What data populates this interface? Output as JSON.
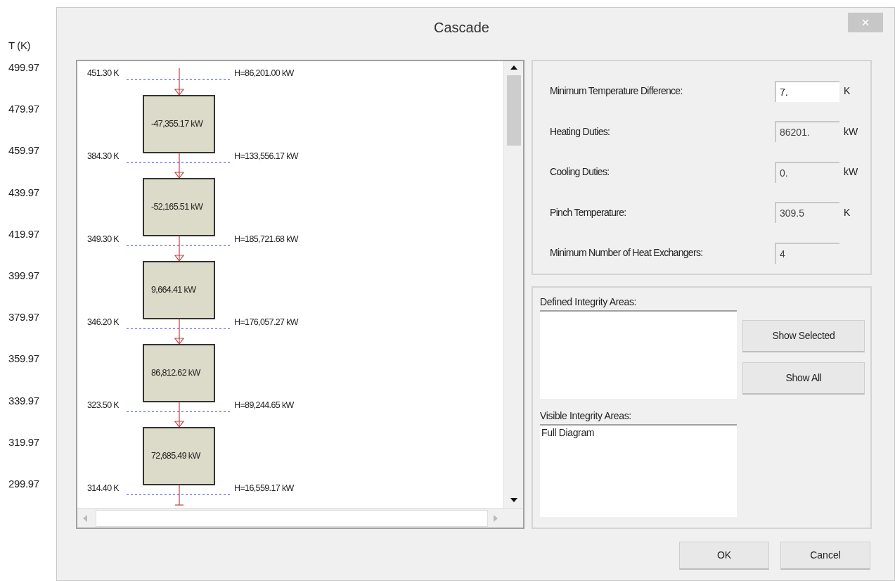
{
  "window": {
    "title": "Cascade"
  },
  "axis": {
    "label": "T (K)",
    "ticks": [
      "499.97",
      "479.97",
      "459.97",
      "439.97",
      "419.97",
      "399.97",
      "379.97",
      "359.97",
      "339.97",
      "319.97",
      "299.97"
    ]
  },
  "cascade": {
    "levels": [
      {
        "temperature": "451.30 K",
        "enthalpy": "H=86,201.00 kW"
      },
      {
        "temperature": "384.30 K",
        "enthalpy": "H=133,556.17 kW"
      },
      {
        "temperature": "349.30 K",
        "enthalpy": "H=185,721.68 kW"
      },
      {
        "temperature": "346.20 K",
        "enthalpy": "H=176,057.27 kW"
      },
      {
        "temperature": "323.50 K",
        "enthalpy": "H=89,244.65 kW"
      },
      {
        "temperature": "314.40 K",
        "enthalpy": "H=16,559.17 kW"
      }
    ],
    "intervals": [
      {
        "duty": "-47,355.17 kW"
      },
      {
        "duty": "-52,165.51 kW"
      },
      {
        "duty": "9,664.41 kW"
      },
      {
        "duty": "86,812.62 kW"
      },
      {
        "duty": "72,685.49 kW"
      }
    ]
  },
  "fields": [
    {
      "label": "Minimum Temperature Difference:",
      "value": "7.",
      "unit": "K",
      "readonly": false
    },
    {
      "label": "Heating Duties:",
      "value": "86201.",
      "unit": "kW",
      "readonly": true
    },
    {
      "label": "Cooling Duties:",
      "value": "0.",
      "unit": "kW",
      "readonly": true
    },
    {
      "label": "Pinch Temperature:",
      "value": "309.5",
      "unit": "K",
      "readonly": true
    },
    {
      "label": "Minimum Number of Heat Exchangers:",
      "value": "4",
      "readonly": true
    }
  ],
  "defined_areas": {
    "label": "Defined Integrity Areas:"
  },
  "visible_areas": {
    "label": "Visible Integrity Areas:",
    "items": [
      {
        "text": "Full Diagram",
        "selected": false
      }
    ]
  },
  "area_buttons": [
    "Show Selected",
    "Show All"
  ],
  "buttons": [
    "OK",
    "Cancel"
  ]
}
